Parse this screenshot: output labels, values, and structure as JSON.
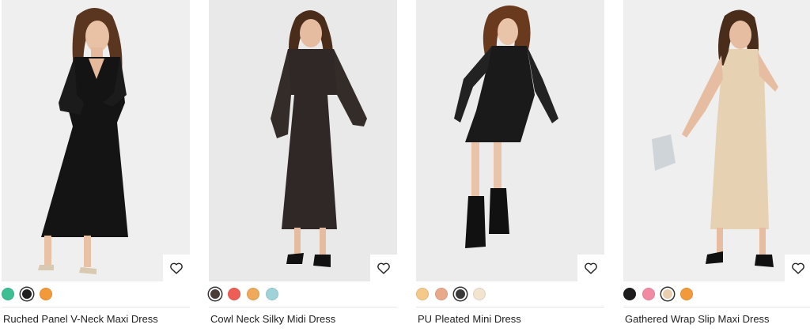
{
  "products": [
    {
      "name": "Ruched Panel V-Neck Maxi Dress",
      "wishlist_icon": "heart-outline-icon",
      "swatches": [
        {
          "color": "#3dbf93",
          "selected": false
        },
        {
          "color": "#1f1f1f",
          "selected": true
        },
        {
          "color": "#f29a3a",
          "selected": false
        }
      ]
    },
    {
      "name": "Cowl Neck Silky Midi Dress",
      "wishlist_icon": "heart-outline-icon",
      "swatches": [
        {
          "color": "#4a3c36",
          "selected": true
        },
        {
          "color": "#ef5e54",
          "selected": false
        },
        {
          "color": "#f0a95a",
          "selected": false
        },
        {
          "color": "#9fd3d8",
          "selected": false
        }
      ]
    },
    {
      "name": "PU Pleated Mini Dress",
      "wishlist_icon": "heart-outline-icon",
      "swatches": [
        {
          "color": "#f4c98a",
          "selected": false
        },
        {
          "color": "#e8a88a",
          "selected": false
        },
        {
          "color": "#3a3a3a",
          "selected": true
        },
        {
          "color": "#f3e4cf",
          "selected": false
        }
      ]
    },
    {
      "name": "Gathered Wrap Slip Maxi Dress",
      "wishlist_icon": "heart-outline-icon",
      "swatches": [
        {
          "color": "#1c1c1c",
          "selected": false
        },
        {
          "color": "#f28aa4",
          "selected": false
        },
        {
          "color": "#e9cfae",
          "selected": true
        },
        {
          "color": "#f29a3a",
          "selected": false
        }
      ]
    }
  ]
}
